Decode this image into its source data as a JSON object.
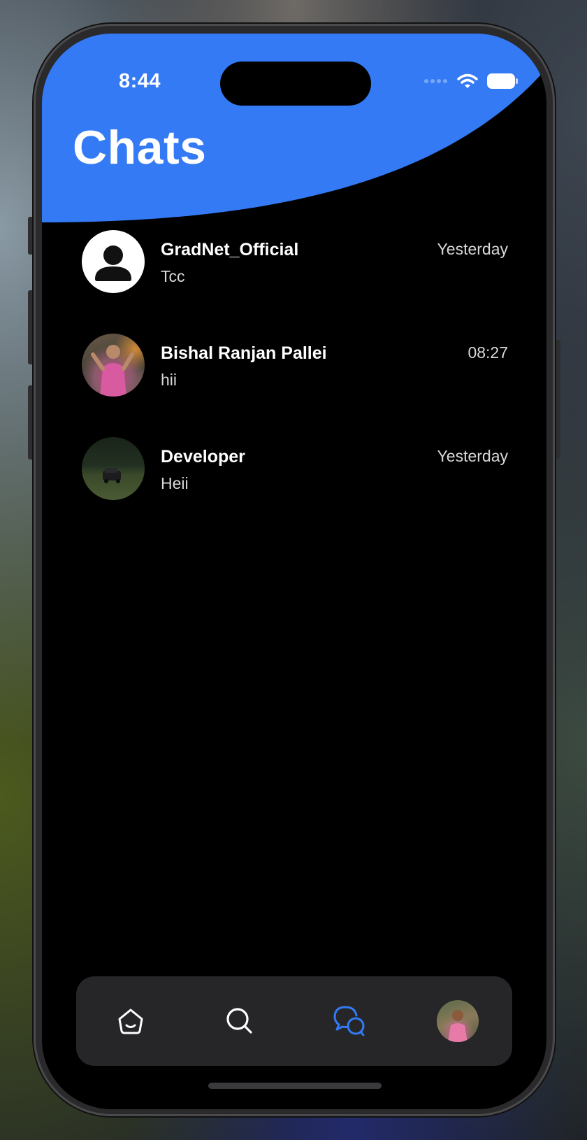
{
  "status_bar": {
    "time": "8:44"
  },
  "header": {
    "title": "Chats",
    "accent_color": "#347AF4"
  },
  "chats": [
    {
      "name": "GradNet_Official",
      "preview": "Tcc",
      "time": "Yesterday",
      "avatar": "default-person-icon"
    },
    {
      "name": "Bishal Ranjan Pallei",
      "preview": "hii",
      "time": "08:27",
      "avatar": "photo"
    },
    {
      "name": "Developer",
      "preview": "Heii",
      "time": "Yesterday",
      "avatar": "photo"
    }
  ],
  "tab_bar": {
    "items": [
      {
        "icon": "home-icon",
        "active": false
      },
      {
        "icon": "search-icon",
        "active": false
      },
      {
        "icon": "chats-icon",
        "active": true
      },
      {
        "icon": "profile-avatar",
        "active": false
      }
    ],
    "active_color": "#347AF4"
  }
}
